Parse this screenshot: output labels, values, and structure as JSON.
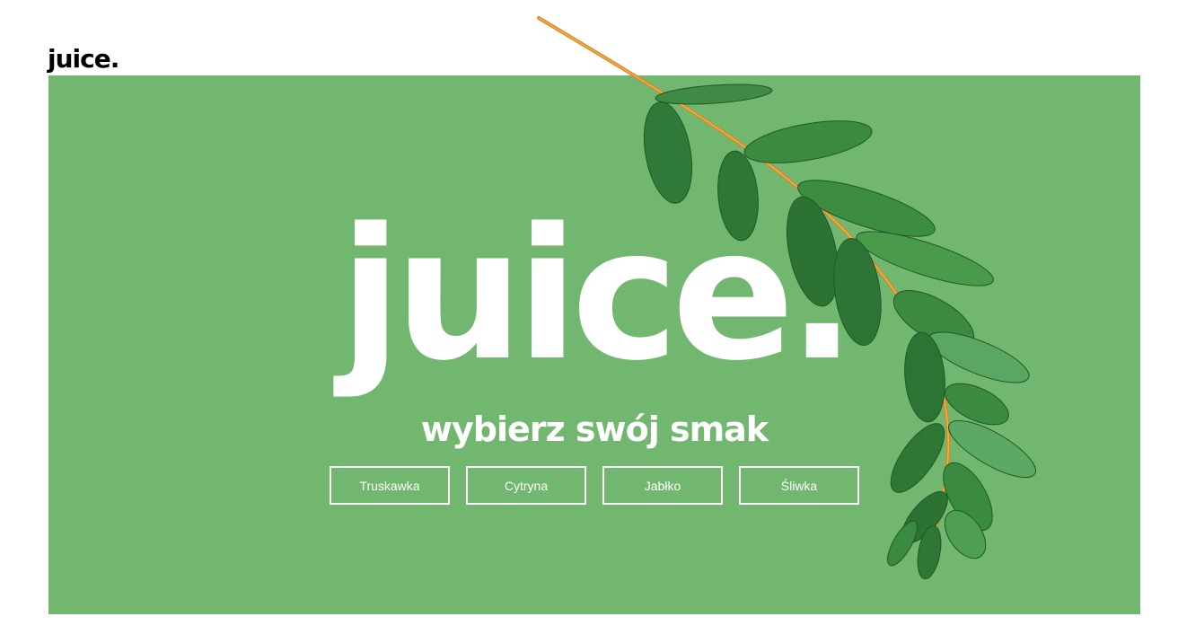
{
  "header": {
    "logo_text": "juice."
  },
  "hero": {
    "title": "juice.",
    "subtitle": "wybierz swój smak",
    "background_color": "#72b76f",
    "decoration": "eucalyptus-branch"
  },
  "flavors": [
    {
      "label": "Truskawka"
    },
    {
      "label": "Cytryna"
    },
    {
      "label": "Jabłko"
    },
    {
      "label": "Śliwka"
    }
  ]
}
